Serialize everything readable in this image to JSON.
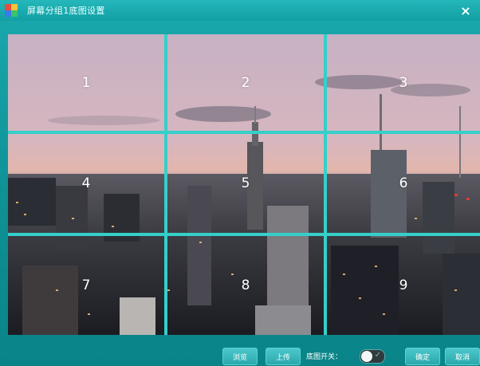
{
  "window": {
    "title": "屏幕分组1底图设置",
    "close_glyph": "×"
  },
  "grid": {
    "cells": [
      "1",
      "2",
      "3",
      "4",
      "5",
      "6",
      "7",
      "8",
      "9"
    ]
  },
  "footer": {
    "browse_label": "浏览",
    "upload_label": "上传",
    "switch_label": "底图开关：",
    "switch_on": true,
    "ok_label": "确定",
    "cancel_label": "取消"
  },
  "colors": {
    "accent": "#1aa9ad",
    "grid_line": "#35cfc9",
    "button": "#3bb8bc"
  }
}
